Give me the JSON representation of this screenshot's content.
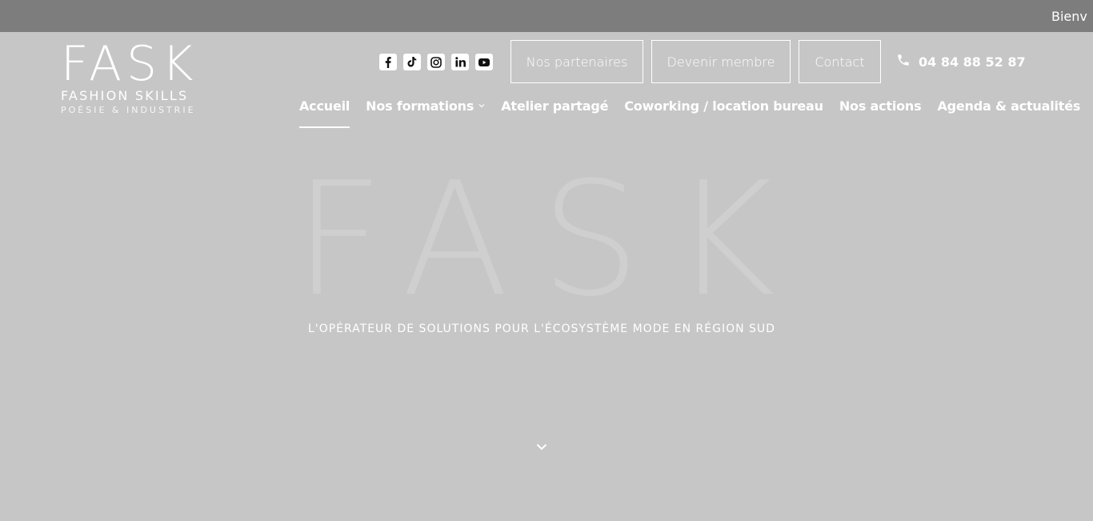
{
  "topbar": {
    "text": "Bienv"
  },
  "logo": {
    "main": "FASK",
    "sub": "FASHION SKILLS",
    "tagline": "POÉSIE & INDUSTRIE"
  },
  "socials": [
    {
      "label": "f",
      "icon": "facebook-icon"
    },
    {
      "label": "tiktok",
      "icon": "tiktok-icon"
    },
    {
      "label": "instagram",
      "icon": "instagram-icon"
    },
    {
      "label": "in",
      "icon": "linkedin-icon"
    },
    {
      "label": "youtube",
      "icon": "youtube-icon"
    }
  ],
  "header_buttons": {
    "partners": "Nos partenaires",
    "member": "Devenir membre",
    "contact": "Contact"
  },
  "phone": {
    "number": "04 84 88 52 87",
    "icon": "phone-icon"
  },
  "nav": {
    "home": "Accueil",
    "trainings": "Nos formations",
    "workshop": "Atelier partagé",
    "coworking": "Coworking / location bureau",
    "actions": "Nos actions",
    "agenda": "Agenda & actualités"
  },
  "hero": {
    "big": "FASK",
    "tagline": "L'OPÉRATEUR DE SOLUTIONS POUR L'ÉCOSYSTÈME MODE EN RÉGION SUD"
  },
  "colors": {
    "topbar": "#7d7d7d",
    "background": "#c6c6c6",
    "text": "#ffffff"
  }
}
